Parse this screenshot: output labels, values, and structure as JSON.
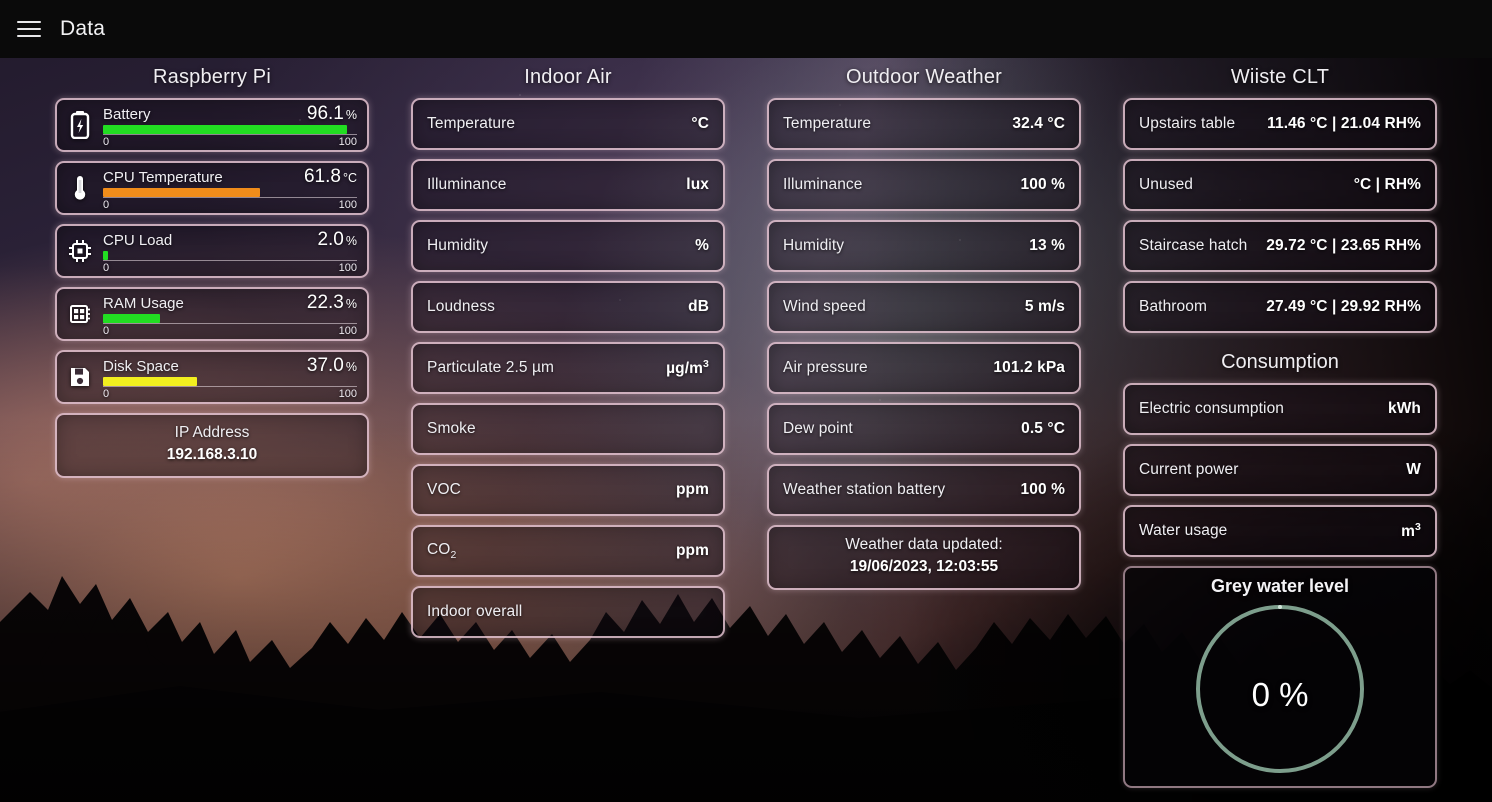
{
  "app": {
    "title": "Data",
    "menu_icon": "hamburger-menu-icon",
    "accent_border": "#f3cfdd",
    "bar_colors": {
      "green": "#22dd22",
      "orange": "#f08c1a",
      "yellow": "#f2ef1f"
    },
    "ring_color": "#7d9e8c"
  },
  "columns": [
    {
      "title": "Raspberry Pi"
    },
    {
      "title": "Indoor Air"
    },
    {
      "title": "Outdoor Weather"
    },
    {
      "title": "Wiiste CLT"
    }
  ],
  "raspberry_pi": {
    "gauges": [
      {
        "icon": "battery-icon",
        "label": "Battery",
        "value": "96.1",
        "unit": "%",
        "min": "0",
        "max": "100",
        "percent": 96.1,
        "color": "#22dd22"
      },
      {
        "icon": "thermometer-icon",
        "label": "CPU Temperature",
        "value": "61.8",
        "unit": "°C",
        "min": "0",
        "max": "100",
        "percent": 61.8,
        "color": "#f08c1a"
      },
      {
        "icon": "cpu-chip-icon",
        "label": "CPU Load",
        "value": "2.0",
        "unit": "%",
        "min": "0",
        "max": "100",
        "percent": 2.0,
        "color": "#22dd22"
      },
      {
        "icon": "memory-chip-icon",
        "label": "RAM Usage",
        "value": "22.3",
        "unit": "%",
        "min": "0",
        "max": "100",
        "percent": 22.3,
        "color": "#22dd22"
      },
      {
        "icon": "floppy-disk-icon",
        "label": "Disk Space",
        "value": "37.0",
        "unit": "%",
        "min": "0",
        "max": "100",
        "percent": 37.0,
        "color": "#f2ef1f"
      }
    ],
    "ip_card": {
      "label": "IP Address",
      "value": "192.168.3.10"
    }
  },
  "indoor_air": {
    "rows": [
      {
        "label": "Temperature",
        "value": "°C"
      },
      {
        "label": "Illuminance",
        "value": "lux"
      },
      {
        "label": "Humidity",
        "value": "%"
      },
      {
        "label": "Loudness",
        "value": "dB"
      },
      {
        "label": "Particulate 2.5 µm",
        "value": "µg/m",
        "sup": "3"
      },
      {
        "label": "Smoke",
        "value": ""
      },
      {
        "label": "VOC",
        "value": "ppm"
      },
      {
        "label": "CO",
        "sub": "2",
        "value": "ppm"
      },
      {
        "label": "Indoor overall",
        "value": ""
      }
    ]
  },
  "outdoor_weather": {
    "rows": [
      {
        "label": "Temperature",
        "value": "32.4 °C"
      },
      {
        "label": "Illuminance",
        "value": "100 %"
      },
      {
        "label": "Humidity",
        "value": "13 %"
      },
      {
        "label": "Wind speed",
        "value": "5 m/s"
      },
      {
        "label": "Air pressure",
        "value": "101.2 kPa"
      },
      {
        "label": "Dew point",
        "value": "0.5 °C"
      },
      {
        "label": "Weather station battery",
        "value": "100 %"
      }
    ],
    "updated_card": {
      "label": "Weather data updated:",
      "value": "19/06/2023, 12:03:55"
    }
  },
  "wiiste_clt": {
    "rows": [
      {
        "label": "Upstairs table",
        "value": "11.46 °C | 21.04 RH%"
      },
      {
        "label": "Unused",
        "value": "°C | RH%"
      },
      {
        "label": "Staircase hatch",
        "value": "29.72 °C | 23.65 RH%"
      },
      {
        "label": "Bathroom",
        "value": "27.49 °C | 29.92 RH%"
      }
    ]
  },
  "consumption": {
    "title": "Consumption",
    "rows": [
      {
        "label": "Electric consumption",
        "value": "kWh"
      },
      {
        "label": "Current power",
        "value": "W"
      },
      {
        "label": "Water usage",
        "value": "m",
        "sup": "3"
      }
    ],
    "grey_water": {
      "title": "Grey water level",
      "value": "0 %",
      "percent": 0
    }
  }
}
